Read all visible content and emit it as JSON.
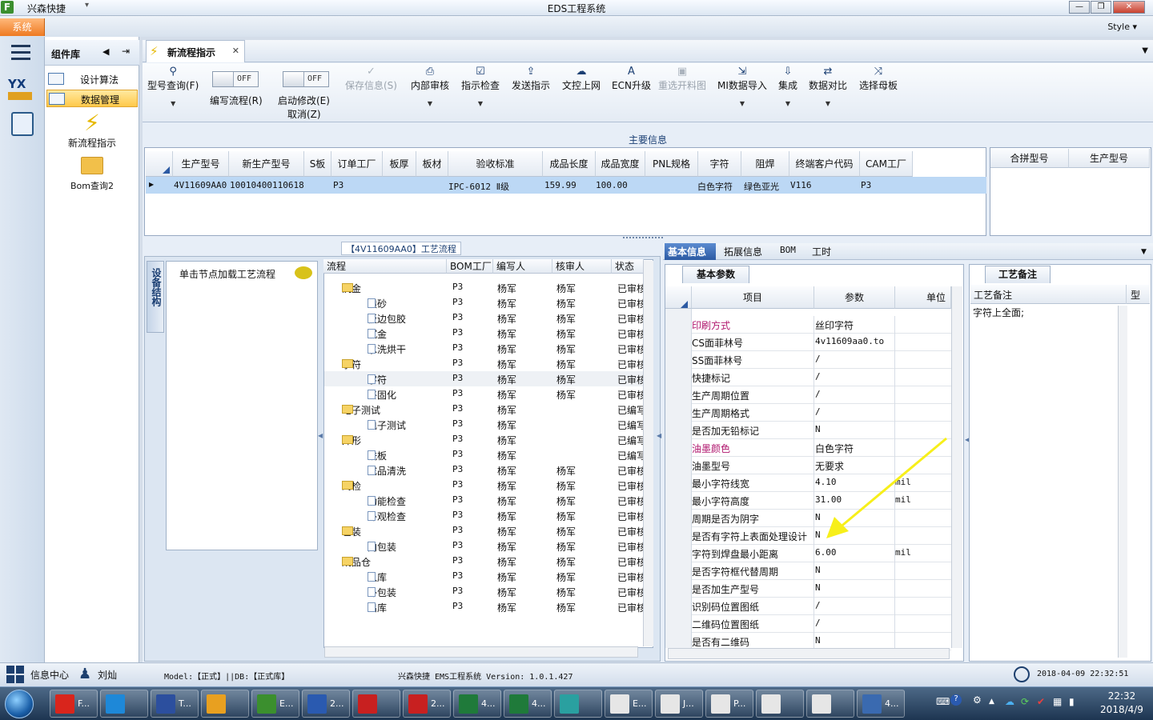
{
  "titlebar": {
    "app_name": "兴森快捷",
    "title": "EDS工程系统",
    "style_label": "Style"
  },
  "menu": {
    "system": "系统"
  },
  "component_panel": {
    "title": "组件库",
    "items": [
      {
        "label": "设计算法"
      },
      {
        "label": "数据管理"
      }
    ],
    "big_items": [
      {
        "label": "新流程指示"
      },
      {
        "label": "Bom查询2"
      }
    ]
  },
  "tab": {
    "label": "新流程指示"
  },
  "ribbon": {
    "query": "型号查询(F)",
    "toggle1": {
      "state": "OFF",
      "label": "编写流程(R)"
    },
    "toggle2": {
      "state": "OFF",
      "label1": "启动修改(E)",
      "label2": "取消(Z)"
    },
    "buttons": [
      {
        "label": "保存信息(S)",
        "disabled": true
      },
      {
        "label": "内部审核"
      },
      {
        "label": "指示检查"
      },
      {
        "label": "发送指示"
      },
      {
        "label": "文控上网"
      },
      {
        "label": "ECN升级"
      },
      {
        "label": "重选开料图",
        "disabled": true
      },
      {
        "label": "MI数据导入"
      },
      {
        "label": "集成"
      },
      {
        "label": "数据对比"
      },
      {
        "label": "选择母板"
      }
    ]
  },
  "main_info": {
    "title": "主要信息",
    "columns": [
      "生产型号",
      "新生产型号",
      "S板",
      "订单工厂",
      "板厚",
      "板材",
      "验收标准",
      "成品长度",
      "成品宽度",
      "PNL规格",
      "字符",
      "阻焊",
      "终端客户代码",
      "CAM工厂"
    ],
    "row": [
      "4V11609AA0",
      "10010400110618",
      "",
      "P3",
      "",
      "",
      "IPC-6012 Ⅱ级",
      "159.99",
      "100.00",
      "",
      "白色字符",
      "绿色亚光",
      "V116",
      "P3"
    ],
    "right_columns": [
      "合拼型号",
      "生产型号"
    ]
  },
  "process": {
    "title": "【4V11609AA0】工艺流程",
    "vtab": "设备结构",
    "node_hint": "单击节点加载工艺流程",
    "columns": [
      "流程",
      "BOM工厂",
      "编写人",
      "核审人",
      "状态"
    ],
    "rows": [
      {
        "name": "沉金",
        "type": "folder",
        "factory": "P3",
        "writer": "杨军",
        "reviewer": "杨军",
        "status": "已审核"
      },
      {
        "name": "喷砂",
        "type": "doc",
        "factory": "P3",
        "writer": "杨军",
        "reviewer": "杨军",
        "status": "已审核"
      },
      {
        "name": "板边包胶",
        "type": "doc",
        "factory": "P3",
        "writer": "杨军",
        "reviewer": "杨军",
        "status": "已审核"
      },
      {
        "name": "沉金",
        "type": "doc",
        "factory": "P3",
        "writer": "杨军",
        "reviewer": "杨军",
        "status": "已审核"
      },
      {
        "name": "水洗烘干",
        "type": "doc",
        "factory": "P3",
        "writer": "杨军",
        "reviewer": "杨军",
        "status": "已审核"
      },
      {
        "name": "字符",
        "type": "folder",
        "factory": "P3",
        "writer": "杨军",
        "reviewer": "杨军",
        "status": "已审核"
      },
      {
        "name": "字符",
        "type": "doc",
        "factory": "P3",
        "writer": "杨军",
        "reviewer": "杨军",
        "status": "已审核",
        "selected": true
      },
      {
        "name": "终固化",
        "type": "doc",
        "factory": "P3",
        "writer": "杨军",
        "reviewer": "杨军",
        "status": "已审核"
      },
      {
        "name": "电子测试",
        "type": "folder",
        "factory": "P3",
        "writer": "杨军",
        "reviewer": "",
        "status": "已编写"
      },
      {
        "name": "电子测试",
        "type": "doc",
        "factory": "P3",
        "writer": "杨军",
        "reviewer": "",
        "status": "已编写"
      },
      {
        "name": "外形",
        "type": "folder",
        "factory": "P3",
        "writer": "杨军",
        "reviewer": "",
        "status": "已编写"
      },
      {
        "name": "铣板",
        "type": "doc",
        "factory": "P3",
        "writer": "杨军",
        "reviewer": "",
        "status": "已编写"
      },
      {
        "name": "成品清洗",
        "type": "doc",
        "factory": "P3",
        "writer": "杨军",
        "reviewer": "杨军",
        "status": "已审核"
      },
      {
        "name": "终检",
        "type": "folder",
        "factory": "P3",
        "writer": "杨军",
        "reviewer": "杨军",
        "status": "已审核"
      },
      {
        "name": "功能检查",
        "type": "doc",
        "factory": "P3",
        "writer": "杨军",
        "reviewer": "杨军",
        "status": "已审核"
      },
      {
        "name": "外观检查",
        "type": "doc",
        "factory": "P3",
        "writer": "杨军",
        "reviewer": "杨军",
        "status": "已审核"
      },
      {
        "name": "包装",
        "type": "folder",
        "factory": "P3",
        "writer": "杨军",
        "reviewer": "杨军",
        "status": "已审核"
      },
      {
        "name": "内包装",
        "type": "doc",
        "factory": "P3",
        "writer": "杨军",
        "reviewer": "杨军",
        "status": "已审核"
      },
      {
        "name": "成品仓",
        "type": "folder",
        "factory": "P3",
        "writer": "杨军",
        "reviewer": "杨军",
        "status": "已审核"
      },
      {
        "name": "入库",
        "type": "doc",
        "factory": "P3",
        "writer": "杨军",
        "reviewer": "杨军",
        "status": "已审核"
      },
      {
        "name": "外包装",
        "type": "doc",
        "factory": "P3",
        "writer": "杨军",
        "reviewer": "杨军",
        "status": "已审核"
      },
      {
        "name": "出库",
        "type": "doc",
        "factory": "P3",
        "writer": "杨军",
        "reviewer": "杨军",
        "status": "已审核"
      }
    ]
  },
  "info_tabs": [
    "基本信息",
    "拓展信息",
    "BOM",
    "工时"
  ],
  "basic": {
    "tab": "基本参数",
    "columns": [
      "项目",
      "参数",
      "单位"
    ],
    "rows": [
      {
        "k": "印刷方式",
        "v": "丝印字符",
        "u": "",
        "hl": true
      },
      {
        "k": "CS面菲林号",
        "v": "4v11609aa0.to",
        "u": ""
      },
      {
        "k": "SS面菲林号",
        "v": "/",
        "u": ""
      },
      {
        "k": "快捷标记",
        "v": "/",
        "u": ""
      },
      {
        "k": "生产周期位置",
        "v": "/",
        "u": ""
      },
      {
        "k": "生产周期格式",
        "v": "/",
        "u": ""
      },
      {
        "k": "是否加无铅标记",
        "v": "N",
        "u": ""
      },
      {
        "k": "油墨颜色",
        "v": "白色字符",
        "u": "",
        "hl": true
      },
      {
        "k": "油墨型号",
        "v": "无要求",
        "u": ""
      },
      {
        "k": "最小字符线宽",
        "v": "4.10",
        "u": "mil"
      },
      {
        "k": "最小字符高度",
        "v": "31.00",
        "u": "mil"
      },
      {
        "k": "周期是否为阴字",
        "v": "N",
        "u": ""
      },
      {
        "k": "是否有字符上表面处理设计",
        "v": "N",
        "u": ""
      },
      {
        "k": "字符到焊盘最小距离",
        "v": "6.00",
        "u": "mil"
      },
      {
        "k": "是否字符框代替周期",
        "v": "N",
        "u": ""
      },
      {
        "k": "是否加生产型号",
        "v": "N",
        "u": ""
      },
      {
        "k": "识别码位置图纸",
        "v": "/",
        "u": ""
      },
      {
        "k": "二维码位置图纸",
        "v": "/",
        "u": ""
      },
      {
        "k": "是否有二维码",
        "v": "N",
        "u": ""
      }
    ]
  },
  "remarks": {
    "tab": "工艺备注",
    "header": "工艺备注",
    "header2": "型",
    "text": "字符上全面;"
  },
  "statusbar": {
    "info_center": "信息中心",
    "user": "刘灿",
    "model": "Model:【正式】||DB:【正式库】",
    "version": "兴森快捷 EMS工程系统 Version: 1.0.1.427",
    "datetime": "2018-04-09 22:32:51"
  },
  "taskbar": {
    "items": [
      {
        "label": "F...",
        "color": "#d9251c"
      },
      {
        "label": "",
        "color": "#1e88d8"
      },
      {
        "label": "T...",
        "color": "#2c4f9e"
      },
      {
        "label": "",
        "color": "#e8a020"
      },
      {
        "label": "E...",
        "color": "#3b8f2e"
      },
      {
        "label": "2...",
        "color": "#2a5ab0"
      },
      {
        "label": "",
        "color": "#c82020"
      },
      {
        "label": "2...",
        "color": "#c82020"
      },
      {
        "label": "4...",
        "color": "#1f7a3a"
      },
      {
        "label": "4...",
        "color": "#1f7a3a"
      },
      {
        "label": "",
        "color": "#2aa0a0"
      },
      {
        "label": "E...",
        "color": "#e6e6e6"
      },
      {
        "label": "J...",
        "color": "#e6e6e6"
      },
      {
        "label": "P...",
        "color": "#e6e6e6"
      },
      {
        "label": "",
        "color": "#e6e6e6"
      },
      {
        "label": "",
        "color": "#e6e6e6"
      },
      {
        "label": "4...",
        "color": "#3a6ab0"
      }
    ],
    "time": "22:32",
    "date": "2018/4/9"
  }
}
